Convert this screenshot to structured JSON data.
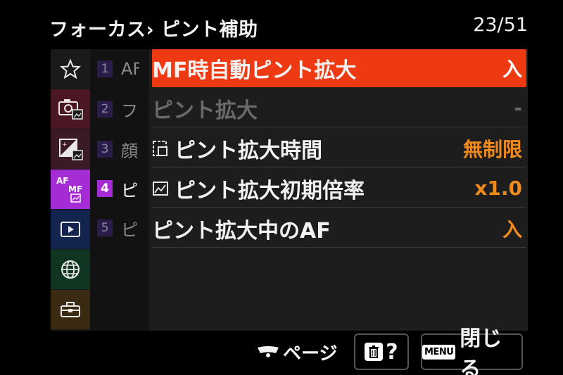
{
  "header": {
    "breadcrumb": "フォーカス› ピント補助",
    "page_counter": "23/51"
  },
  "categories": [
    {
      "name": "my-menu",
      "icon": "star-icon",
      "color": "#1a1a1a"
    },
    {
      "name": "shooting",
      "icon": "camera-icon",
      "color": "#4a1722"
    },
    {
      "name": "exposure-color",
      "icon": "exposure-icon",
      "color": "#3a1a24"
    },
    {
      "name": "focus",
      "icon": "af-mf-icon",
      "color": "#a52cd4",
      "label_af": "AF",
      "label_mf": "MF"
    },
    {
      "name": "playback",
      "icon": "play-icon",
      "color": "#13244f"
    },
    {
      "name": "network",
      "icon": "globe-icon",
      "color": "#103521"
    },
    {
      "name": "setup",
      "icon": "toolbox-icon",
      "color": "#3a2a12"
    }
  ],
  "sub_pages": [
    {
      "num": "1",
      "text": "AF"
    },
    {
      "num": "2",
      "text": "フ"
    },
    {
      "num": "3",
      "text": "顔"
    },
    {
      "num": "4",
      "text": "ピ"
    },
    {
      "num": "5",
      "text": "ピ"
    }
  ],
  "menu": [
    {
      "label": "MF時自動ピント拡大",
      "value": "入",
      "state": "selected",
      "icon": ""
    },
    {
      "label": "ピント拡大",
      "value": "-",
      "state": "disabled",
      "icon": ""
    },
    {
      "label": "ピント拡大時間",
      "value": "無制限",
      "state": "normal",
      "icon": "magnify-time-icon"
    },
    {
      "label": "ピント拡大初期倍率",
      "value": "x1.0",
      "state": "normal",
      "icon": "magnify-scale-icon"
    },
    {
      "label": "ピント拡大中のAF",
      "value": "入",
      "state": "normal",
      "icon": ""
    }
  ],
  "footer": {
    "page_label": "ページ",
    "help_label": "?",
    "menu_key": "MENU",
    "close_label": "閉じる"
  }
}
